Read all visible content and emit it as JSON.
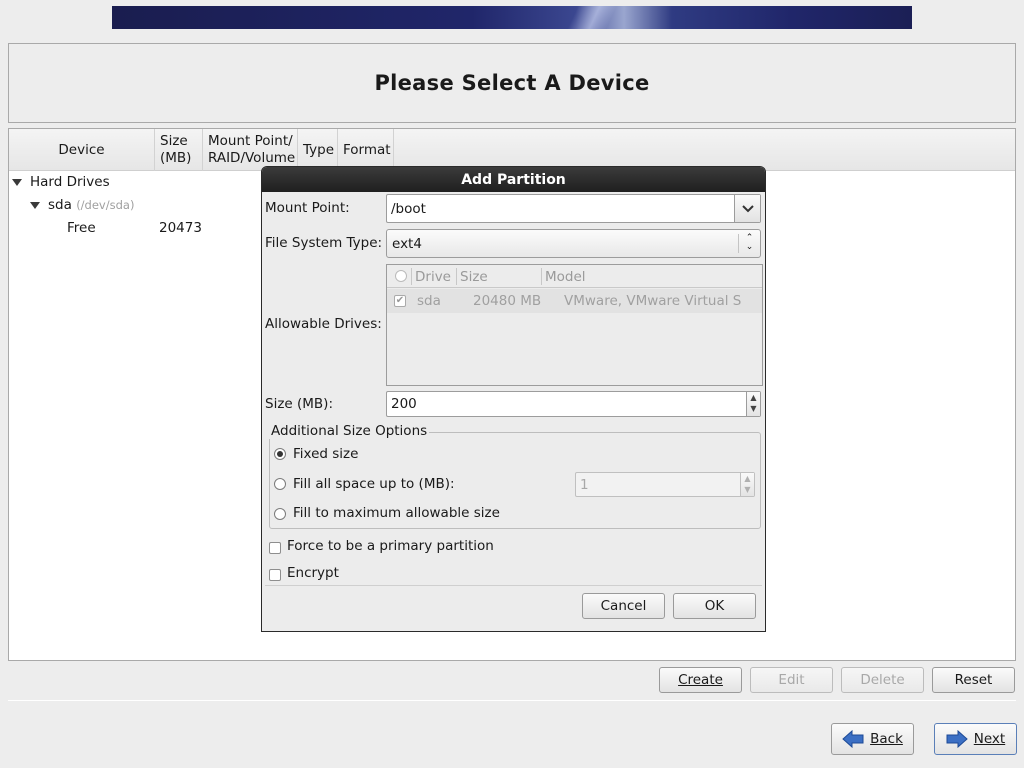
{
  "header": {
    "title": "Please Select A Device"
  },
  "table": {
    "columns": [
      "Device",
      "Size\n(MB)",
      "Mount Point/\nRAID/Volume",
      "Type",
      "Format"
    ],
    "tree": {
      "group_label": "Hard Drives",
      "disk_name": "sda",
      "disk_path": "(/dev/sda)",
      "free_label": "Free",
      "free_size": "20473"
    }
  },
  "actions": {
    "create": "Create",
    "edit": "Edit",
    "delete": "Delete",
    "reset": "Reset"
  },
  "nav": {
    "back": "Back",
    "next": "Next"
  },
  "dialog": {
    "title": "Add Partition",
    "mount_point_label": "Mount Point:",
    "mount_point_value": "/boot",
    "fs_type_label": "File System Type:",
    "fs_type_value": "ext4",
    "allowable_drives_label": "Allowable Drives:",
    "drives_columns": {
      "drive": "Drive",
      "size": "Size",
      "model": "Model"
    },
    "drives_rows": [
      {
        "checked": true,
        "drive": "sda",
        "size": "20480 MB",
        "model": "VMware, VMware Virtual S"
      }
    ],
    "size_label": "Size (MB):",
    "size_value": "200",
    "size_options_legend": "Additional Size Options",
    "opt_fixed": "Fixed size",
    "opt_fill_upto": "Fill all space up to (MB):",
    "fill_upto_value": "1",
    "opt_fill_max": "Fill to maximum allowable size",
    "selected_option": "fixed",
    "primary_label": "Force to be a primary partition",
    "encrypt_label": "Encrypt",
    "cancel": "Cancel",
    "ok": "OK"
  }
}
